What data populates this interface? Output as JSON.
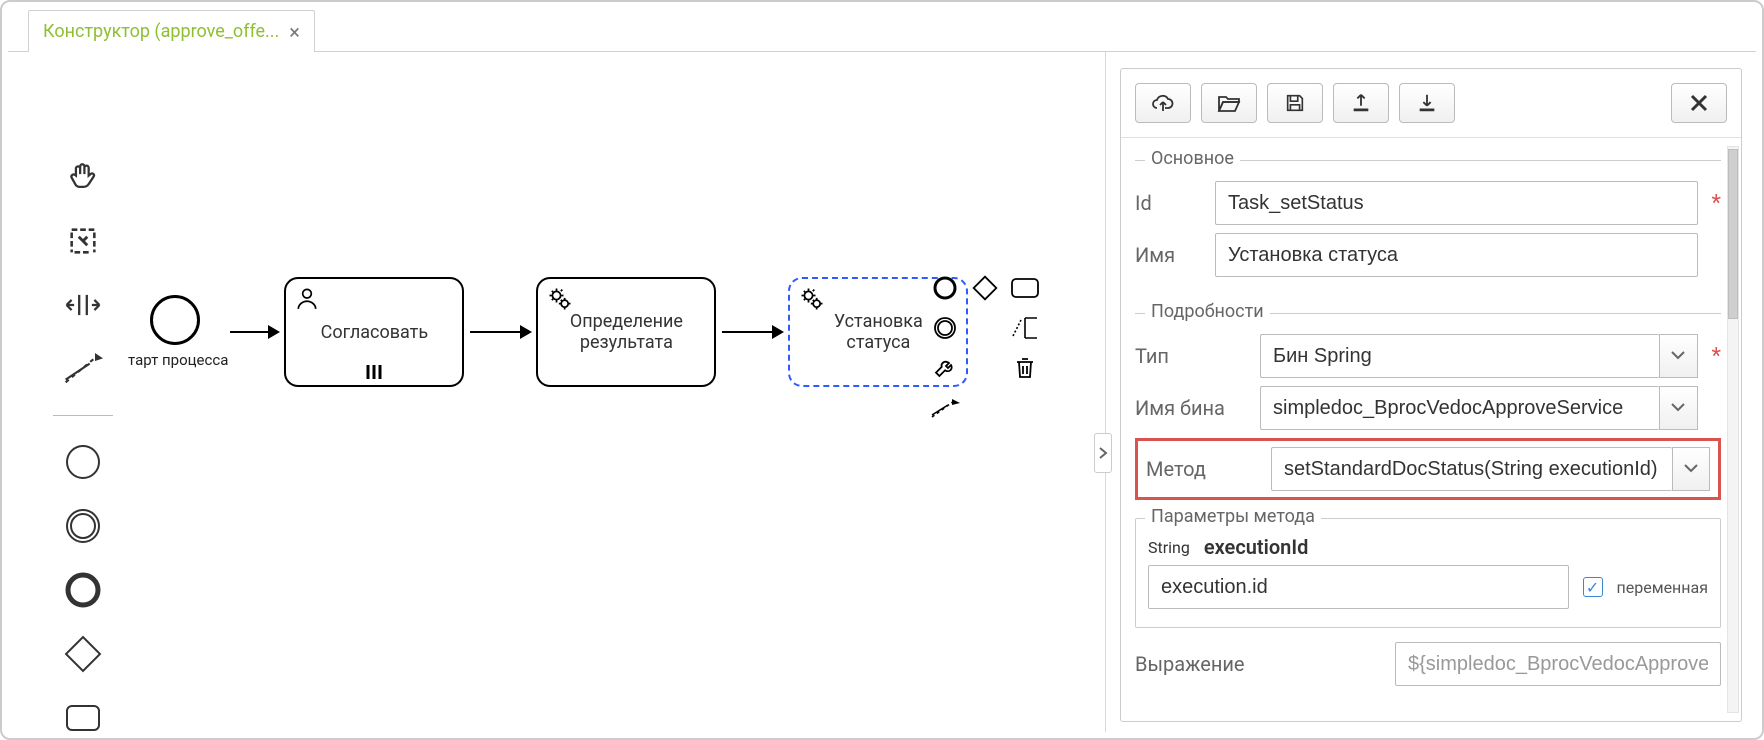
{
  "tab": {
    "title": "Конструктор (approve_offe...",
    "close_label": "×"
  },
  "canvas": {
    "start_label": "тарт процесса",
    "task1": "Согласовать",
    "task2_line1": "Определение",
    "task2_line2": "результата",
    "task3_line1": "Установка",
    "task3_line2": "статуса"
  },
  "panel": {
    "group_main": "Основное",
    "label_id": "Id",
    "value_id": "Task_setStatus",
    "label_name": "Имя",
    "value_name": "Установка статуса",
    "group_details": "Подробности",
    "label_type": "Тип",
    "value_type": "Бин Spring",
    "label_bean": "Имя бина",
    "value_bean": "simpledoc_BprocVedocApproveService",
    "label_method": "Метод",
    "value_method": "setStandardDocStatus(String executionId)",
    "group_params": "Параметры метода",
    "param_type": "String",
    "param_name": "executionId",
    "param_value": "execution.id",
    "param_var_label": "переменная",
    "label_expr": "Выражение",
    "value_expr": "${simpledoc_BprocVedocApproveS"
  },
  "icons": {
    "hand": "hand-icon",
    "lasso": "lasso-icon",
    "space": "space-icon",
    "connection": "connection-icon",
    "start_event": "start-event-icon",
    "intermediate": "intermediate-event-icon",
    "end_event": "end-event-icon",
    "gateway": "gateway-icon",
    "subprocess": "subprocess-icon",
    "user": "user-icon",
    "gears": "gear-icon",
    "bars": "bars-icon",
    "cloud_up": "cloud-upload-icon",
    "open": "open-icon",
    "save": "save-icon",
    "upload": "upload-icon",
    "download": "download-icon",
    "close": "close-icon",
    "chev": "chevron-down-icon",
    "trash": "trash-icon",
    "wrench": "wrench-icon",
    "text": "text-icon"
  }
}
